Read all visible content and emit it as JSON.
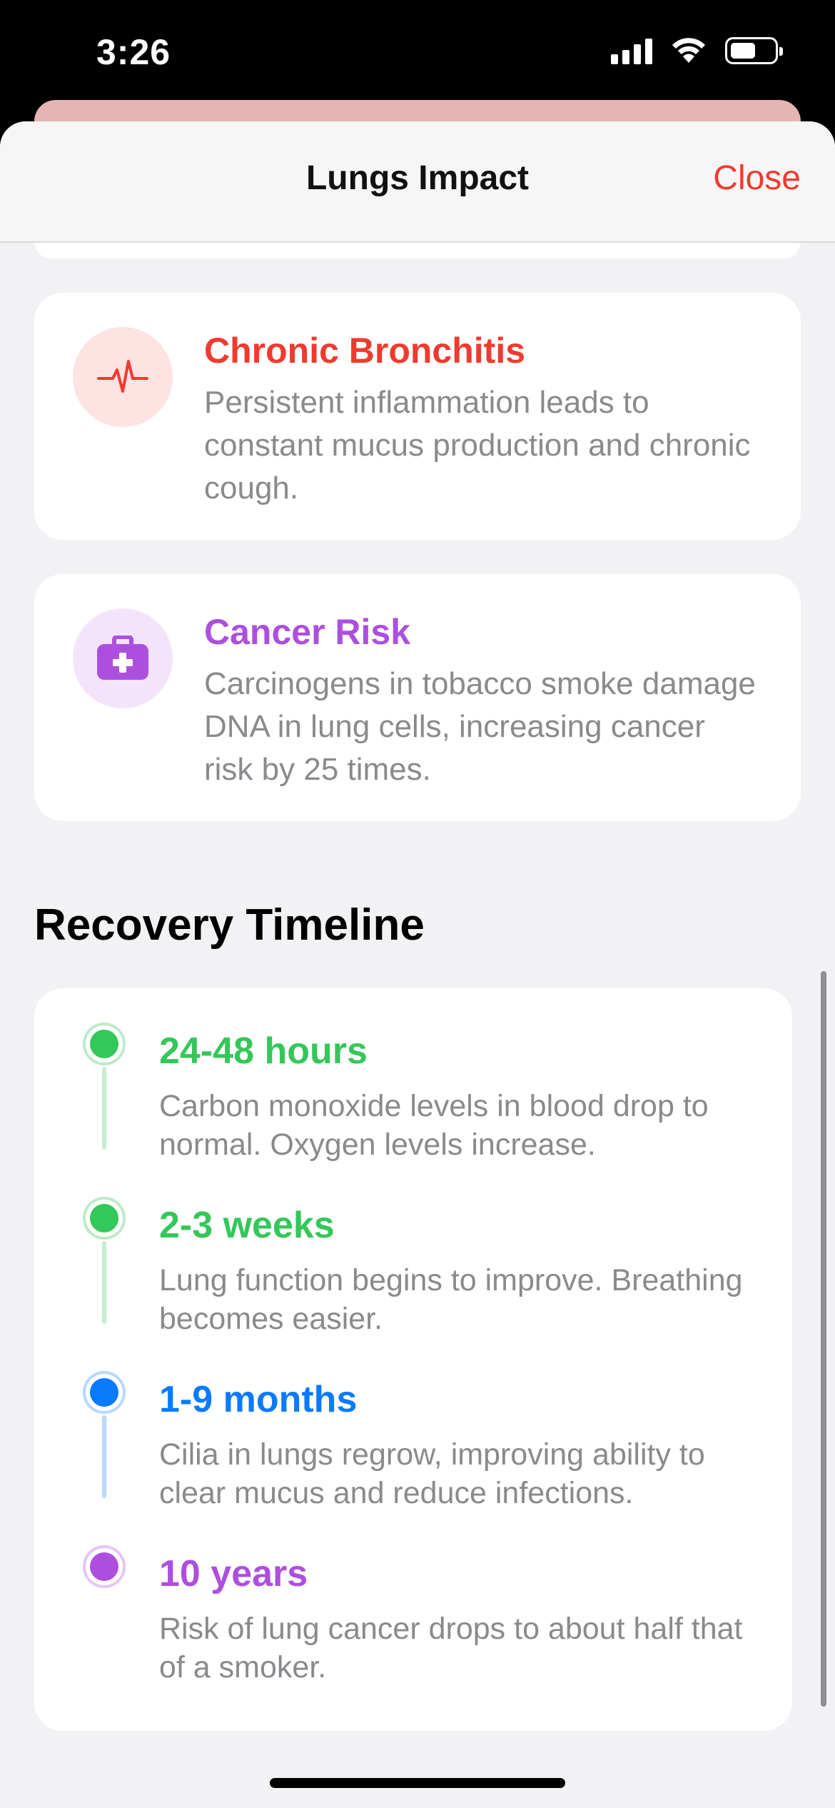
{
  "status": {
    "time": "3:26"
  },
  "sheet": {
    "title": "Lungs Impact",
    "close_label": "Close"
  },
  "impacts": [
    {
      "title": "Chronic Bronchitis",
      "description": "Persistent inflammation leads to constant mucus production and chronic cough.",
      "icon": "heartbeat-icon",
      "color": "#f03a2e",
      "icon_bg": "#fde3e1"
    },
    {
      "title": "Cancer Risk",
      "description": "Carcinogens in tobacco smoke damage DNA in lung cells, increasing cancer risk by 25 times.",
      "icon": "medical-kit-icon",
      "color": "#ad4fde",
      "icon_bg": "#f3e4fb"
    }
  ],
  "recovery": {
    "title": "Recovery Timeline",
    "items": [
      {
        "title": "24-48 hours",
        "description": "Carbon monoxide levels in blood drop to normal. Oxygen levels increase.",
        "color": "#34c759"
      },
      {
        "title": "2-3 weeks",
        "description": "Lung function begins to improve. Breathing becomes easier.",
        "color": "#34c759"
      },
      {
        "title": "1-9 months",
        "description": "Cilia in lungs regrow, improving ability to clear mucus and reduce infections.",
        "color": "#0a7aff"
      },
      {
        "title": "10 years",
        "description": "Risk of lung cancer drops to about half that of a smoker.",
        "color": "#ad4fde"
      }
    ]
  }
}
